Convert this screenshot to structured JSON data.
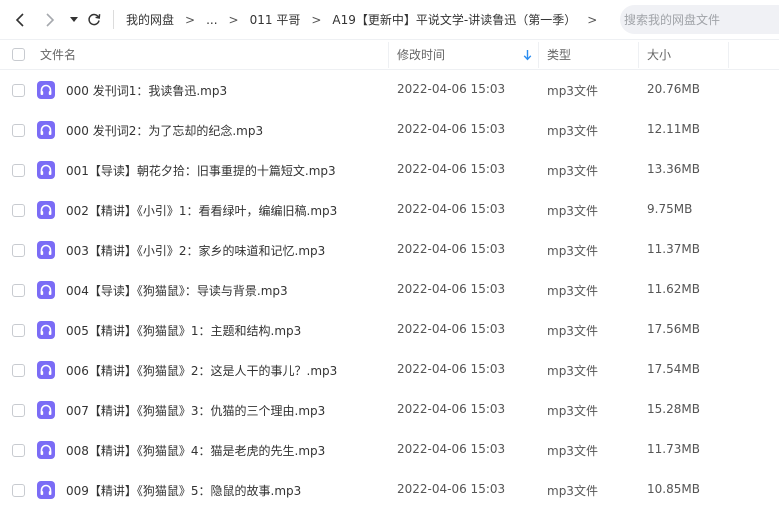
{
  "breadcrumb": {
    "items": [
      "我的网盘",
      "...",
      "011 平哥",
      "A19【更新中】平说文学-讲读鲁迅（第一季）"
    ],
    "separator": ">"
  },
  "search": {
    "placeholder": "搜索我的网盘文件"
  },
  "columns": {
    "name": "文件名",
    "modified": "修改时间",
    "type": "类型",
    "size": "大小"
  },
  "sort": {
    "column": "modified",
    "direction": "descending"
  },
  "colors": {
    "icon_bg": "#7b6cf6",
    "sort_arrow": "#2a8cf0"
  },
  "files": [
    {
      "name": "000 发刊词1：我读鲁迅.mp3",
      "modified": "2022-04-06 15:03",
      "type": "mp3文件",
      "size": "20.76MB"
    },
    {
      "name": "000 发刊词2：为了忘却的纪念.mp3",
      "modified": "2022-04-06 15:03",
      "type": "mp3文件",
      "size": "12.11MB"
    },
    {
      "name": "001【导读】朝花夕拾：旧事重提的十篇短文.mp3",
      "modified": "2022-04-06 15:03",
      "type": "mp3文件",
      "size": "13.36MB"
    },
    {
      "name": "002【精讲】《小引》1：看看绿叶，编编旧稿.mp3",
      "modified": "2022-04-06 15:03",
      "type": "mp3文件",
      "size": "9.75MB"
    },
    {
      "name": "003【精讲】《小引》2：家乡的味道和记忆.mp3",
      "modified": "2022-04-06 15:03",
      "type": "mp3文件",
      "size": "11.37MB"
    },
    {
      "name": "004【导读】《狗猫鼠》：导读与背景.mp3",
      "modified": "2022-04-06 15:03",
      "type": "mp3文件",
      "size": "11.62MB"
    },
    {
      "name": "005【精讲】《狗猫鼠》1：主题和结构.mp3",
      "modified": "2022-04-06 15:03",
      "type": "mp3文件",
      "size": "17.56MB"
    },
    {
      "name": "006【精讲】《狗猫鼠》2：这是人干的事儿？.mp3",
      "modified": "2022-04-06 15:03",
      "type": "mp3文件",
      "size": "17.54MB"
    },
    {
      "name": "007【精讲】《狗猫鼠》3：仇猫的三个理由.mp3",
      "modified": "2022-04-06 15:03",
      "type": "mp3文件",
      "size": "15.28MB"
    },
    {
      "name": "008【精讲】《狗猫鼠》4：猫是老虎的先生.mp3",
      "modified": "2022-04-06 15:03",
      "type": "mp3文件",
      "size": "11.73MB"
    },
    {
      "name": "009【精讲】《狗猫鼠》5：隐鼠的故事.mp3",
      "modified": "2022-04-06 15:03",
      "type": "mp3文件",
      "size": "10.85MB"
    }
  ]
}
